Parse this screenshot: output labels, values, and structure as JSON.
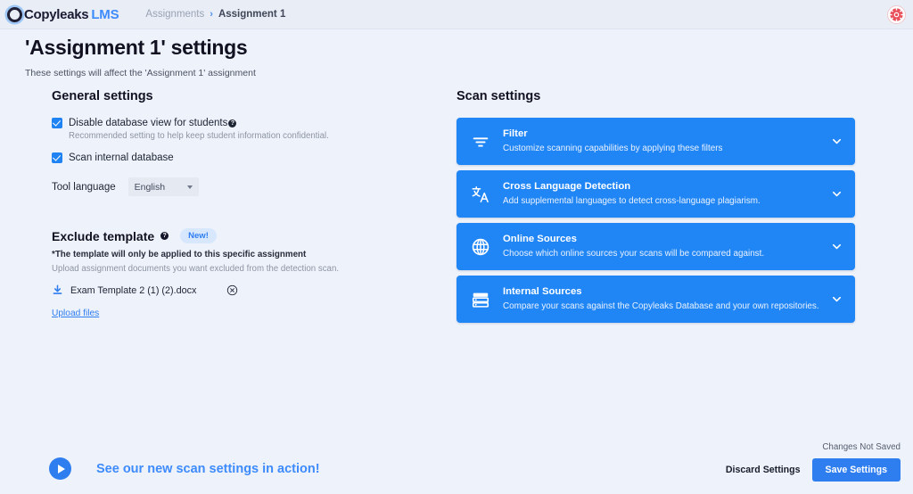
{
  "header": {
    "logo_name": "Copyleaks",
    "logo_suffix": "LMS",
    "breadcrumb_root": "Assignments",
    "breadcrumb_sep": "›",
    "breadcrumb_current": "Assignment 1",
    "avatar_name": "user-avatar"
  },
  "page": {
    "title": "'Assignment 1' settings",
    "subtitle": "These settings will affect the 'Assignment 1' assignment"
  },
  "general": {
    "section_title": "General settings",
    "disable_db_label": "Disable database view for students",
    "disable_db_info": "?",
    "disable_db_hint": "Recommended setting to help keep student information confidential.",
    "scan_internal_label": "Scan internal database",
    "tool_language_label": "Tool language",
    "tool_language_value": "English"
  },
  "exclude": {
    "title": "Exclude template",
    "info": "?",
    "badge": "New!",
    "note": "*The template will only be applied to this specific assignment",
    "sub": "Upload assignment documents you want excluded from the detection scan.",
    "file_name": "Exam Template 2 (1) (2).docx",
    "upload_link": "Upload files"
  },
  "scan": {
    "section_title": "Scan settings",
    "cards": [
      {
        "icon": "filter-icon",
        "title": "Filter",
        "desc": "Customize scanning capabilities by applying these filters"
      },
      {
        "icon": "translate-icon",
        "title": "Cross Language Detection",
        "desc": "Add supplemental languages to detect cross-language plagiarism."
      },
      {
        "icon": "globe-icon",
        "title": "Online Sources",
        "desc": "Choose which online sources your scans will be compared against."
      },
      {
        "icon": "database-icon",
        "title": "Internal Sources",
        "desc": "Compare your scans against the Copyleaks Database and your own repositories."
      }
    ]
  },
  "footer": {
    "promo_text": "See our new scan settings in action!",
    "status": "Changes Not Saved",
    "discard_label": "Discard Settings",
    "save_label": "Save Settings"
  },
  "colors": {
    "brand_blue": "#2f7ef0",
    "card_blue": "#2186f5",
    "page_bg": "#eef2fa",
    "topbar_bg": "#e9edf6"
  }
}
